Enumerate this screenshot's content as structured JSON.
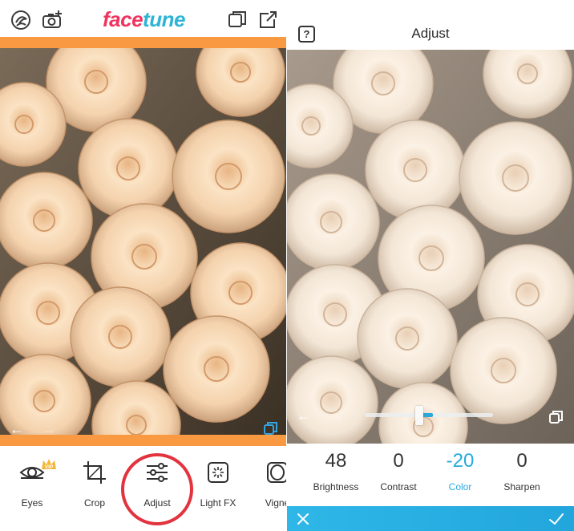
{
  "left": {
    "brand": {
      "part1": "face",
      "part2": "tune"
    },
    "icons": {
      "profile": "faceswirl-icon",
      "camera": "camera-plus-icon",
      "compare_pages": "copy-icon",
      "share": "share-icon",
      "back": "arrow-left-icon",
      "forward": "arrow-right-icon",
      "before_after": "compare-icon"
    },
    "tools": [
      {
        "label": "Eyes",
        "icon": "eye-icon",
        "badge": "VIP"
      },
      {
        "label": "Crop",
        "icon": "crop-icon"
      },
      {
        "label": "Adjust",
        "icon": "sliders-icon"
      },
      {
        "label": "Light FX",
        "icon": "light-fx-icon"
      },
      {
        "label": "Vigne",
        "icon": "vignette-icon"
      }
    ]
  },
  "right": {
    "title": "Adjust",
    "help_label": "?",
    "slider": {
      "value": -20,
      "fill_fraction": 0.09
    },
    "params": [
      {
        "value": "48",
        "label": "Brightness"
      },
      {
        "value": "0",
        "label": "Contrast"
      },
      {
        "value": "-20",
        "label": "Color",
        "active": true
      },
      {
        "value": "0",
        "label": "Sharpen"
      }
    ],
    "actions": {
      "cancel": "close-icon",
      "apply": "checkmark-icon"
    }
  },
  "colors": {
    "accent_orange": "#f99a43",
    "accent_blue": "#28a9df",
    "brand_pink": "#f0335f",
    "brand_cyan": "#2db4d6",
    "highlight_red": "#e2333e"
  }
}
